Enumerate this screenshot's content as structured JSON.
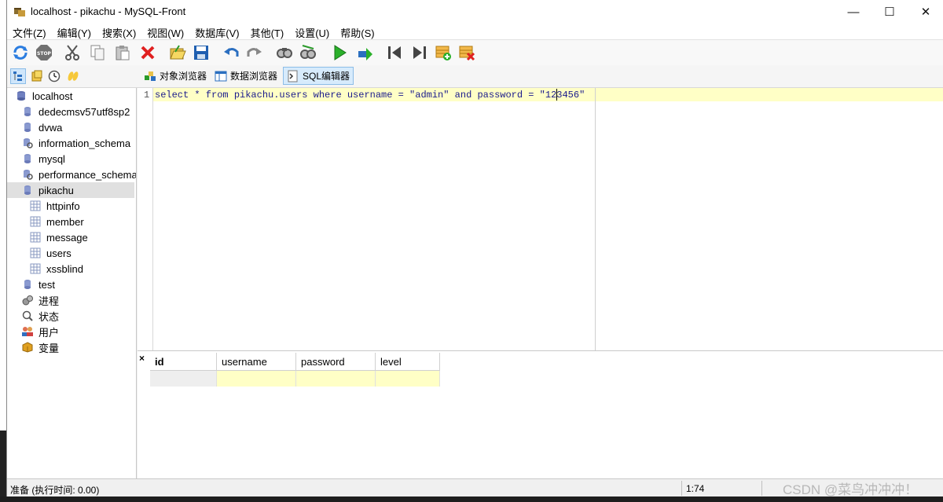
{
  "window": {
    "title": "localhost - pikachu - MySQL-Front",
    "minimize": "—",
    "maximize": "☐",
    "close": "✕"
  },
  "menu": [
    "文件(Z)",
    "编辑(Y)",
    "搜索(X)",
    "视图(W)",
    "数据库(V)",
    "其他(T)",
    "设置(U)",
    "帮助(S)"
  ],
  "toolbar_icons": [
    "refresh-icon",
    "stop-icon",
    "cut-icon",
    "copy-icon",
    "paste-icon",
    "delete-icon",
    "open-icon",
    "save-icon",
    "undo-icon",
    "redo-icon",
    "find-icon",
    "replace-icon",
    "run-icon",
    "run-selection-icon",
    "first-icon",
    "last-icon",
    "insert-record-icon",
    "delete-record-icon"
  ],
  "tabs": {
    "object_browser": "对象浏览器",
    "data_browser": "数据浏览器",
    "sql_editor": "SQL编辑器"
  },
  "tree": {
    "root": "localhost",
    "databases": [
      "dedecmsv57utf8sp2",
      "dvwa",
      "information_schema",
      "mysql",
      "performance_schema",
      "pikachu"
    ],
    "tables": [
      "httpinfo",
      "member",
      "message",
      "users",
      "xssblind"
    ],
    "after": [
      "test"
    ],
    "tools": [
      "进程",
      "状态",
      "用户",
      "变量"
    ]
  },
  "editor": {
    "line_number": "1",
    "sql": "select * from pikachu.users where username = \"admin\" and password = \"123456\""
  },
  "results": {
    "close": "×",
    "columns": [
      "id",
      "username",
      "password",
      "level"
    ]
  },
  "status": {
    "text": "准备  (执行时间: 0.00)",
    "position": "1:74"
  },
  "watermark": "CSDN @菜鸟冲冲冲！"
}
